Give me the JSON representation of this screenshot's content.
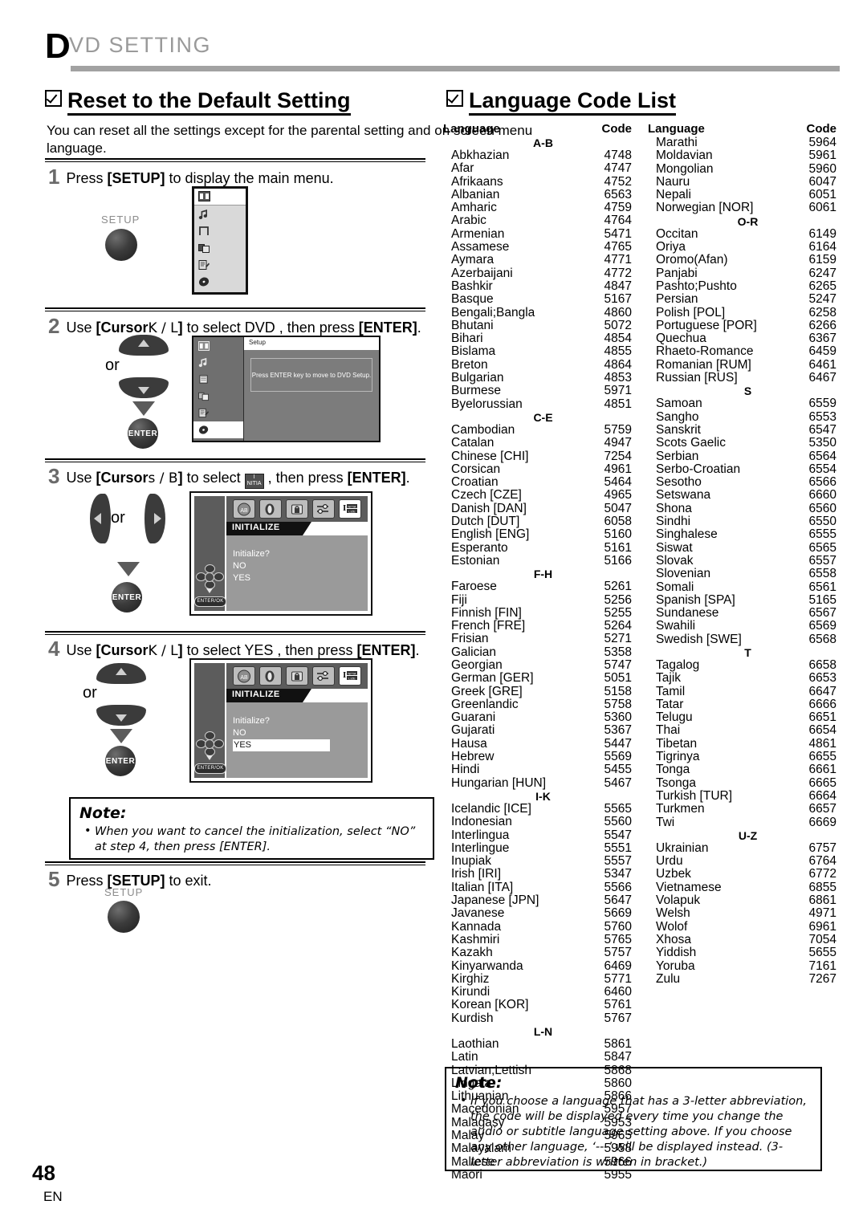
{
  "running_head": {
    "drop_cap": "D",
    "rest": "VD  SETTING"
  },
  "sections": {
    "reset": {
      "title": "Reset to the Default Setting"
    },
    "langcode": {
      "title": "Language Code List"
    }
  },
  "intro": "You can reset all the settings except for the parental setting and on screen menu language.",
  "steps": [
    {
      "num": "1",
      "text_pre": "Press ",
      "key": "[SETUP]",
      "text_post": " to display the main menu.",
      "button_label": "SETUP"
    },
    {
      "num": "2",
      "text_pre": "Use ",
      "key": "[Cursor",
      "cursor_glyphs": "K / L",
      "key_close": "]",
      "text_mid": " to select  DVD , then press ",
      "key2": "[ENTER]",
      "text_post": ".",
      "or_label": "or",
      "enter_label": "ENTER",
      "screen": {
        "title": "Setup",
        "message": "Press ENTER key to move to DVD Setup."
      }
    },
    {
      "num": "3",
      "text_pre": "Use ",
      "key": "[Cursor",
      "cursor_glyphs": "s / B",
      "key_close": "]",
      "text_mid": " to select ",
      "icon": "initialize-icon",
      "text_mid2": " , then press ",
      "key2": "[ENTER]",
      "text_post": ".",
      "or_label": "or",
      "enter_label": "ENTER",
      "screen": {
        "caption": "INITIALIZE",
        "prompt": "Initialize?",
        "options": [
          "NO",
          "YES"
        ],
        "selected": "",
        "enterok": "ENTER/OK"
      }
    },
    {
      "num": "4",
      "text_pre": "Use ",
      "key": "[Cursor",
      "cursor_glyphs": "K / L",
      "key_close": "]",
      "text_mid": " to select  YES , then press ",
      "key2": "[ENTER]",
      "text_post": ".",
      "or_label": "or",
      "enter_label": "ENTER",
      "screen": {
        "caption": "INITIALIZE",
        "prompt": "Initialize?",
        "options": [
          "NO",
          "YES"
        ],
        "selected": "YES",
        "enterok": "ENTER/OK"
      }
    },
    {
      "num": "5",
      "text_pre": "Press ",
      "key": "[SETUP]",
      "text_post": " to exit.",
      "button_label": "SETUP"
    }
  ],
  "note_left": {
    "title": "Note:",
    "items": [
      "When you want to cancel the initialization, select “NO” at step 4, then press [ENTER]."
    ]
  },
  "note_right": {
    "title": "Note:",
    "items": [
      "If you choose a language that has a 3-letter abbreviation, the code will be displayed every time you change the audio or subtitle language setting above. If you choose any other language, ‘---’ will be displayed instead. (3-letter abbreviation is written in bracket.)"
    ]
  },
  "lang_table": {
    "headers": {
      "language": "Language",
      "code": "Code"
    },
    "columns": [
      {
        "blocks": [
          {
            "group": "A-B",
            "rows": [
              {
                "language": "Abkhazian",
                "code": "4748"
              },
              {
                "language": "Afar",
                "code": "4747"
              },
              {
                "language": "Afrikaans",
                "code": "4752"
              },
              {
                "language": "Albanian",
                "code": "6563"
              },
              {
                "language": "Amharic",
                "code": "4759"
              },
              {
                "language": "Arabic",
                "code": "4764"
              },
              {
                "language": "Armenian",
                "code": "5471"
              },
              {
                "language": "Assamese",
                "code": "4765"
              },
              {
                "language": "Aymara",
                "code": "4771"
              },
              {
                "language": "Azerbaijani",
                "code": "4772"
              },
              {
                "language": "Bashkir",
                "code": "4847"
              },
              {
                "language": "Basque",
                "code": "5167"
              },
              {
                "language": "Bengali;Bangla",
                "code": "4860"
              },
              {
                "language": "Bhutani",
                "code": "5072"
              },
              {
                "language": "Bihari",
                "code": "4854"
              },
              {
                "language": "Bislama",
                "code": "4855"
              },
              {
                "language": "Breton",
                "code": "4864"
              },
              {
                "language": "Bulgarian",
                "code": "4853"
              },
              {
                "language": "Burmese",
                "code": "5971"
              },
              {
                "language": "Byelorussian",
                "code": "4851"
              }
            ]
          },
          {
            "group": "C-E",
            "rows": [
              {
                "language": "Cambodian",
                "code": "5759"
              },
              {
                "language": "Catalan",
                "code": "4947"
              },
              {
                "language": "Chinese [CHI]",
                "code": "7254"
              },
              {
                "language": "Corsican",
                "code": "4961"
              },
              {
                "language": "Croatian",
                "code": "5464"
              },
              {
                "language": "Czech [CZE]",
                "code": "4965"
              },
              {
                "language": "Danish [DAN]",
                "code": "5047"
              },
              {
                "language": "Dutch [DUT]",
                "code": "6058"
              },
              {
                "language": "English [ENG]",
                "code": "5160"
              },
              {
                "language": "Esperanto",
                "code": "5161"
              },
              {
                "language": "Estonian",
                "code": "5166"
              }
            ]
          },
          {
            "group": "F-H",
            "rows": [
              {
                "language": "Faroese",
                "code": "5261"
              },
              {
                "language": "Fiji",
                "code": "5256"
              },
              {
                "language": "Finnish [FIN]",
                "code": "5255"
              },
              {
                "language": "French [FRE]",
                "code": "5264"
              },
              {
                "language": "Frisian",
                "code": "5271"
              },
              {
                "language": "Galician",
                "code": "5358"
              },
              {
                "language": "Georgian",
                "code": "5747"
              },
              {
                "language": "German [GER]",
                "code": "5051"
              },
              {
                "language": "Greek [GRE]",
                "code": "5158"
              },
              {
                "language": "Greenlandic",
                "code": "5758"
              },
              {
                "language": "Guarani",
                "code": "5360"
              },
              {
                "language": "Gujarati",
                "code": "5367"
              },
              {
                "language": "Hausa",
                "code": "5447"
              },
              {
                "language": "Hebrew",
                "code": "5569"
              },
              {
                "language": "Hindi",
                "code": "5455"
              },
              {
                "language": "Hungarian [HUN]",
                "code": "5467"
              }
            ]
          },
          {
            "group": "I-K",
            "rows": [
              {
                "language": "Icelandic [ICE]",
                "code": "5565"
              },
              {
                "language": "Indonesian",
                "code": "5560"
              },
              {
                "language": "Interlingua",
                "code": "5547"
              },
              {
                "language": "Interlingue",
                "code": "5551"
              },
              {
                "language": "Inupiak",
                "code": "5557"
              },
              {
                "language": "Irish [IRI]",
                "code": "5347"
              },
              {
                "language": "Italian [ITA]",
                "code": "5566"
              },
              {
                "language": "Japanese [JPN]",
                "code": "5647"
              },
              {
                "language": "Javanese",
                "code": "5669"
              },
              {
                "language": "Kannada",
                "code": "5760"
              },
              {
                "language": "Kashmiri",
                "code": "5765"
              },
              {
                "language": "Kazakh",
                "code": "5757"
              },
              {
                "language": "Kinyarwanda",
                "code": "6469"
              },
              {
                "language": "Kirghiz",
                "code": "5771"
              },
              {
                "language": "Kirundi",
                "code": "6460"
              },
              {
                "language": "Korean [KOR]",
                "code": "5761"
              },
              {
                "language": "Kurdish",
                "code": "5767"
              }
            ]
          },
          {
            "group": "L-N",
            "rows": [
              {
                "language": "Laothian",
                "code": "5861"
              },
              {
                "language": "Latin",
                "code": "5847"
              },
              {
                "language": "Latvian;Lettish",
                "code": "5868"
              },
              {
                "language": "Lingala",
                "code": "5860"
              },
              {
                "language": "Lithuanian",
                "code": "5866"
              },
              {
                "language": "Macedonian",
                "code": "5957"
              },
              {
                "language": "Malagasy",
                "code": "5953"
              },
              {
                "language": "Malay",
                "code": "5965"
              },
              {
                "language": "Malayalam",
                "code": "5958"
              },
              {
                "language": "Maltese",
                "code": "5966"
              },
              {
                "language": "Maori",
                "code": "5955"
              }
            ]
          }
        ]
      },
      {
        "blocks": [
          {
            "group": "",
            "rows": [
              {
                "language": "Marathi",
                "code": "5964"
              },
              {
                "language": "Moldavian",
                "code": "5961"
              },
              {
                "language": "Mongolian",
                "code": "5960"
              },
              {
                "language": "Nauru",
                "code": "6047"
              },
              {
                "language": "Nepali",
                "code": "6051"
              },
              {
                "language": "Norwegian [NOR]",
                "code": "6061"
              }
            ]
          },
          {
            "group": "O-R",
            "rows": [
              {
                "language": "Occitan",
                "code": "6149"
              },
              {
                "language": "Oriya",
                "code": "6164"
              },
              {
                "language": "Oromo(Afan)",
                "code": "6159"
              },
              {
                "language": "Panjabi",
                "code": "6247"
              },
              {
                "language": "Pashto;Pushto",
                "code": "6265"
              },
              {
                "language": "Persian",
                "code": "5247"
              },
              {
                "language": "Polish [POL]",
                "code": "6258"
              },
              {
                "language": "Portuguese [POR]",
                "code": "6266"
              },
              {
                "language": "Quechua",
                "code": "6367"
              },
              {
                "language": "Rhaeto-Romance",
                "code": "6459"
              },
              {
                "language": "Romanian [RUM]",
                "code": "6461"
              },
              {
                "language": "Russian [RUS]",
                "code": "6467"
              }
            ]
          },
          {
            "group": "S",
            "rows": [
              {
                "language": "Samoan",
                "code": "6559"
              },
              {
                "language": "Sangho",
                "code": "6553"
              },
              {
                "language": "Sanskrit",
                "code": "6547"
              },
              {
                "language": "Scots Gaelic",
                "code": "5350"
              },
              {
                "language": "Serbian",
                "code": "6564"
              },
              {
                "language": "Serbo-Croatian",
                "code": "6554"
              },
              {
                "language": "Sesotho",
                "code": "6566"
              },
              {
                "language": "Setswana",
                "code": "6660"
              },
              {
                "language": "Shona",
                "code": "6560"
              },
              {
                "language": "Sindhi",
                "code": "6550"
              },
              {
                "language": "Singhalese",
                "code": "6555"
              },
              {
                "language": "Siswat",
                "code": "6565"
              },
              {
                "language": "Slovak",
                "code": "6557"
              },
              {
                "language": "Slovenian",
                "code": "6558"
              },
              {
                "language": "Somali",
                "code": "6561"
              },
              {
                "language": "Spanish [SPA]",
                "code": "5165"
              },
              {
                "language": "Sundanese",
                "code": "6567"
              },
              {
                "language": "Swahili",
                "code": "6569"
              },
              {
                "language": "Swedish [SWE]",
                "code": "6568"
              }
            ]
          },
          {
            "group": "T",
            "rows": [
              {
                "language": "Tagalog",
                "code": "6658"
              },
              {
                "language": "Tajik",
                "code": "6653"
              },
              {
                "language": "Tamil",
                "code": "6647"
              },
              {
                "language": "Tatar",
                "code": "6666"
              },
              {
                "language": "Telugu",
                "code": "6651"
              },
              {
                "language": "Thai",
                "code": "6654"
              },
              {
                "language": "Tibetan",
                "code": "4861"
              },
              {
                "language": "Tigrinya",
                "code": "6655"
              },
              {
                "language": "Tonga",
                "code": "6661"
              },
              {
                "language": "Tsonga",
                "code": "6665"
              },
              {
                "language": "Turkish [TUR]",
                "code": "6664"
              },
              {
                "language": "Turkmen",
                "code": "6657"
              },
              {
                "language": "Twi",
                "code": "6669"
              }
            ]
          },
          {
            "group": "U-Z",
            "rows": [
              {
                "language": "Ukrainian",
                "code": "6757"
              },
              {
                "language": "Urdu",
                "code": "6764"
              },
              {
                "language": "Uzbek",
                "code": "6772"
              },
              {
                "language": "Vietnamese",
                "code": "6855"
              },
              {
                "language": "Volapuk",
                "code": "6861"
              },
              {
                "language": "Welsh",
                "code": "4971"
              },
              {
                "language": "Wolof",
                "code": "6961"
              },
              {
                "language": "Xhosa",
                "code": "7054"
              },
              {
                "language": "Yiddish",
                "code": "5655"
              },
              {
                "language": "Yoruba",
                "code": "7161"
              },
              {
                "language": "Zulu",
                "code": "7267"
              }
            ]
          }
        ]
      }
    ]
  },
  "footer": {
    "page_number": "48",
    "language_code": "EN"
  }
}
